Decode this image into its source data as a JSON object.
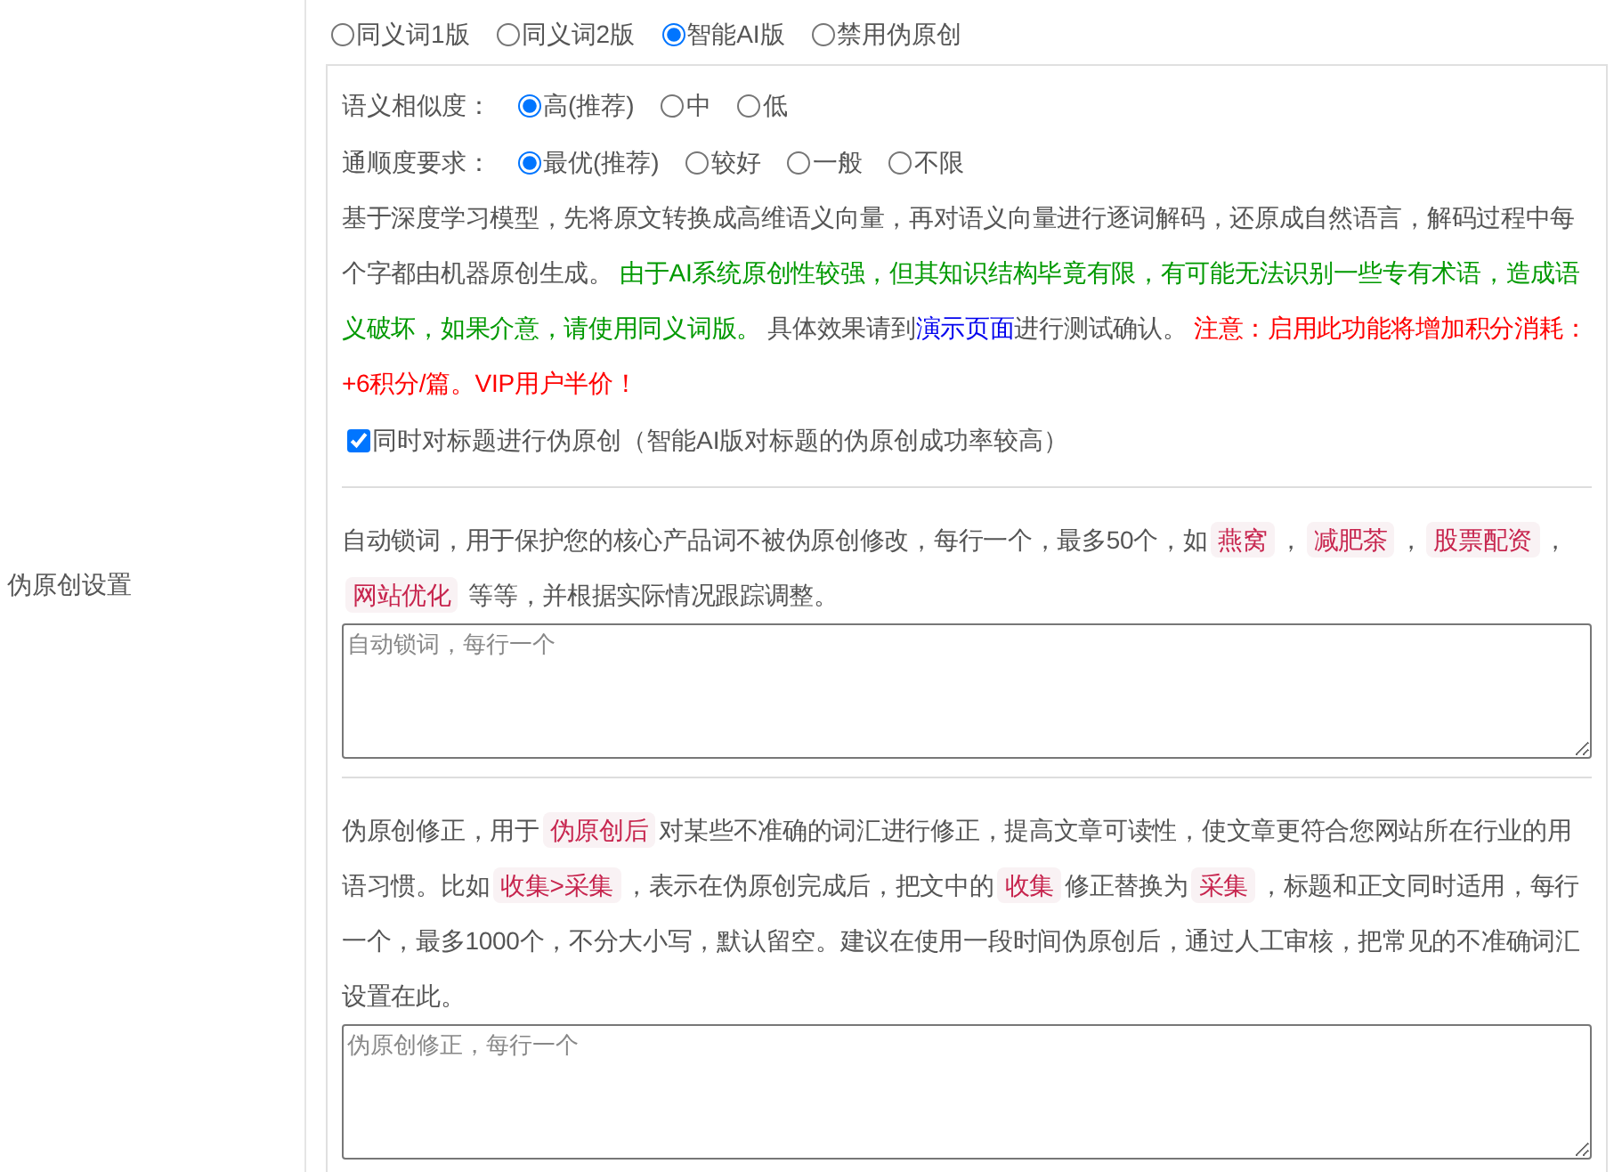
{
  "section_label": "伪原创设置",
  "modes": [
    {
      "label": "同义词1版",
      "selected": false
    },
    {
      "label": "同义词2版",
      "selected": false
    },
    {
      "label": "智能AI版",
      "selected": true
    },
    {
      "label": "禁用伪原创",
      "selected": false
    }
  ],
  "ai_settings": {
    "groups": [
      {
        "label": "语义相似度：",
        "options": [
          {
            "label": "高(推荐)",
            "selected": true
          },
          {
            "label": "中",
            "selected": false
          },
          {
            "label": "低",
            "selected": false
          }
        ]
      },
      {
        "label": "通顺度要求：",
        "options": [
          {
            "label": "最优(推荐)",
            "selected": true
          },
          {
            "label": "较好",
            "selected": false
          },
          {
            "label": "一般",
            "selected": false
          },
          {
            "label": "不限",
            "selected": false
          }
        ]
      }
    ],
    "description": [
      {
        "kind": "text",
        "text": "基于深度学习模型，先将原文转换成高维语义向量，再对语义向量进行逐词解码，还原成自然语言，解码过程中每个字都由机器原创生成。 "
      },
      {
        "kind": "note",
        "text": "由于AI系统原创性较强，但其知识结构毕竟有限，有可能无法识别一些专有术语，造成语义破坏，如果介意，请使用同义词版。"
      },
      {
        "kind": "text",
        "text": " 具体效果请到"
      },
      {
        "kind": "link",
        "text": "演示页面"
      },
      {
        "kind": "text",
        "text": "进行测试确认。 "
      },
      {
        "kind": "warning",
        "text": "注意：启用此功能将增加积分消耗：+6积分/篇。VIP用户半价！"
      }
    ],
    "title_option": {
      "label": "同时对标题进行伪原创（智能AI版对标题的伪原创成功率较高）",
      "checked": true
    }
  },
  "lock_words": {
    "description": [
      {
        "kind": "text",
        "text": "自动锁词，用于保护您的核心产品词不被伪原创修改，每行一个，最多50个，如"
      },
      {
        "kind": "tag",
        "text": "燕窝"
      },
      {
        "kind": "text",
        "text": "，"
      },
      {
        "kind": "tag",
        "text": "减肥茶"
      },
      {
        "kind": "text",
        "text": "，"
      },
      {
        "kind": "tag",
        "text": "股票配资"
      },
      {
        "kind": "text",
        "text": "，"
      },
      {
        "kind": "tag",
        "text": "网站优化"
      },
      {
        "kind": "text",
        "text": " 等等，并根据实际情况跟踪调整。"
      }
    ],
    "placeholder": "自动锁词，每行一个"
  },
  "corrections": {
    "description": [
      {
        "kind": "text",
        "text": "伪原创修正，用于"
      },
      {
        "kind": "tag",
        "text": "伪原创后"
      },
      {
        "kind": "text",
        "text": "对某些不准确的词汇进行修正，提高文章可读性，使文章更符合您网站所在行业的用语习惯。比如"
      },
      {
        "kind": "tag",
        "text": "收集>采集"
      },
      {
        "kind": "text",
        "text": "，表示在伪原创完成后，把文中的"
      },
      {
        "kind": "tag",
        "text": "收集"
      },
      {
        "kind": "text",
        "text": "修正替换为"
      },
      {
        "kind": "tag",
        "text": "采集"
      },
      {
        "kind": "text",
        "text": "，标题和正文同时适用，每行一个，最多1000个，不分大小写，默认留空。建议在使用一段时间伪原创后，通过人工审核，把常见的不准确词汇设置在此。"
      }
    ],
    "placeholder": "伪原创修正，每行一个"
  }
}
